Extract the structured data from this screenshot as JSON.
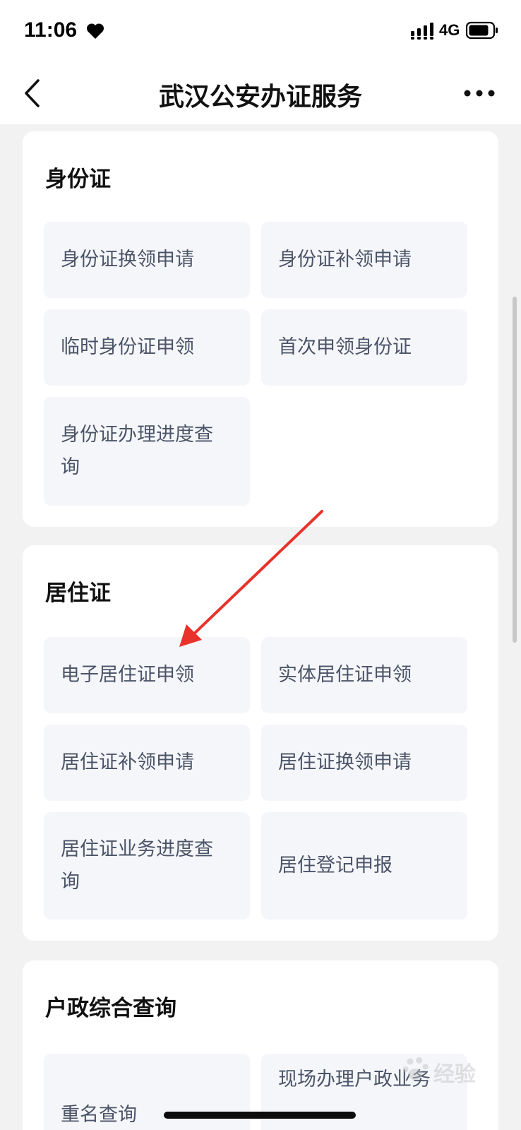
{
  "status_bar": {
    "time": "11:06",
    "network": "4G",
    "icons": [
      "heart-icon",
      "signal-icon",
      "battery-icon"
    ]
  },
  "header": {
    "title": "武汉公安办证服务",
    "back_icon": "chevron-left-icon",
    "more_icon": "more-dots-icon"
  },
  "sections": [
    {
      "title": "身份证",
      "items": [
        {
          "label": "身份证换领申请"
        },
        {
          "label": "身份证补领申请"
        },
        {
          "label": "临时身份证申领"
        },
        {
          "label": "首次申领身份证"
        },
        {
          "label_lines": [
            "身份证办理进度查",
            "询"
          ]
        }
      ]
    },
    {
      "title": "居住证",
      "items": [
        {
          "label": "电子居住证申领"
        },
        {
          "label": "实体居住证申领"
        },
        {
          "label": "居住证补领申请"
        },
        {
          "label": "居住证换领申请"
        },
        {
          "label_lines": [
            "居住证业务进度查",
            "询"
          ]
        },
        {
          "label": "居住登记申报"
        }
      ]
    },
    {
      "title": "户政综合查询",
      "items": [
        {
          "label": "重名查询"
        },
        {
          "label": "现场办理户政业务"
        }
      ]
    }
  ],
  "watermark": {
    "text": "经验"
  },
  "colors": {
    "background": "#f2f2f2",
    "card": "#ffffff",
    "tile": "#f5f6f9",
    "tile_text": "#4b5468",
    "annotation_arrow": "#e8322b"
  }
}
